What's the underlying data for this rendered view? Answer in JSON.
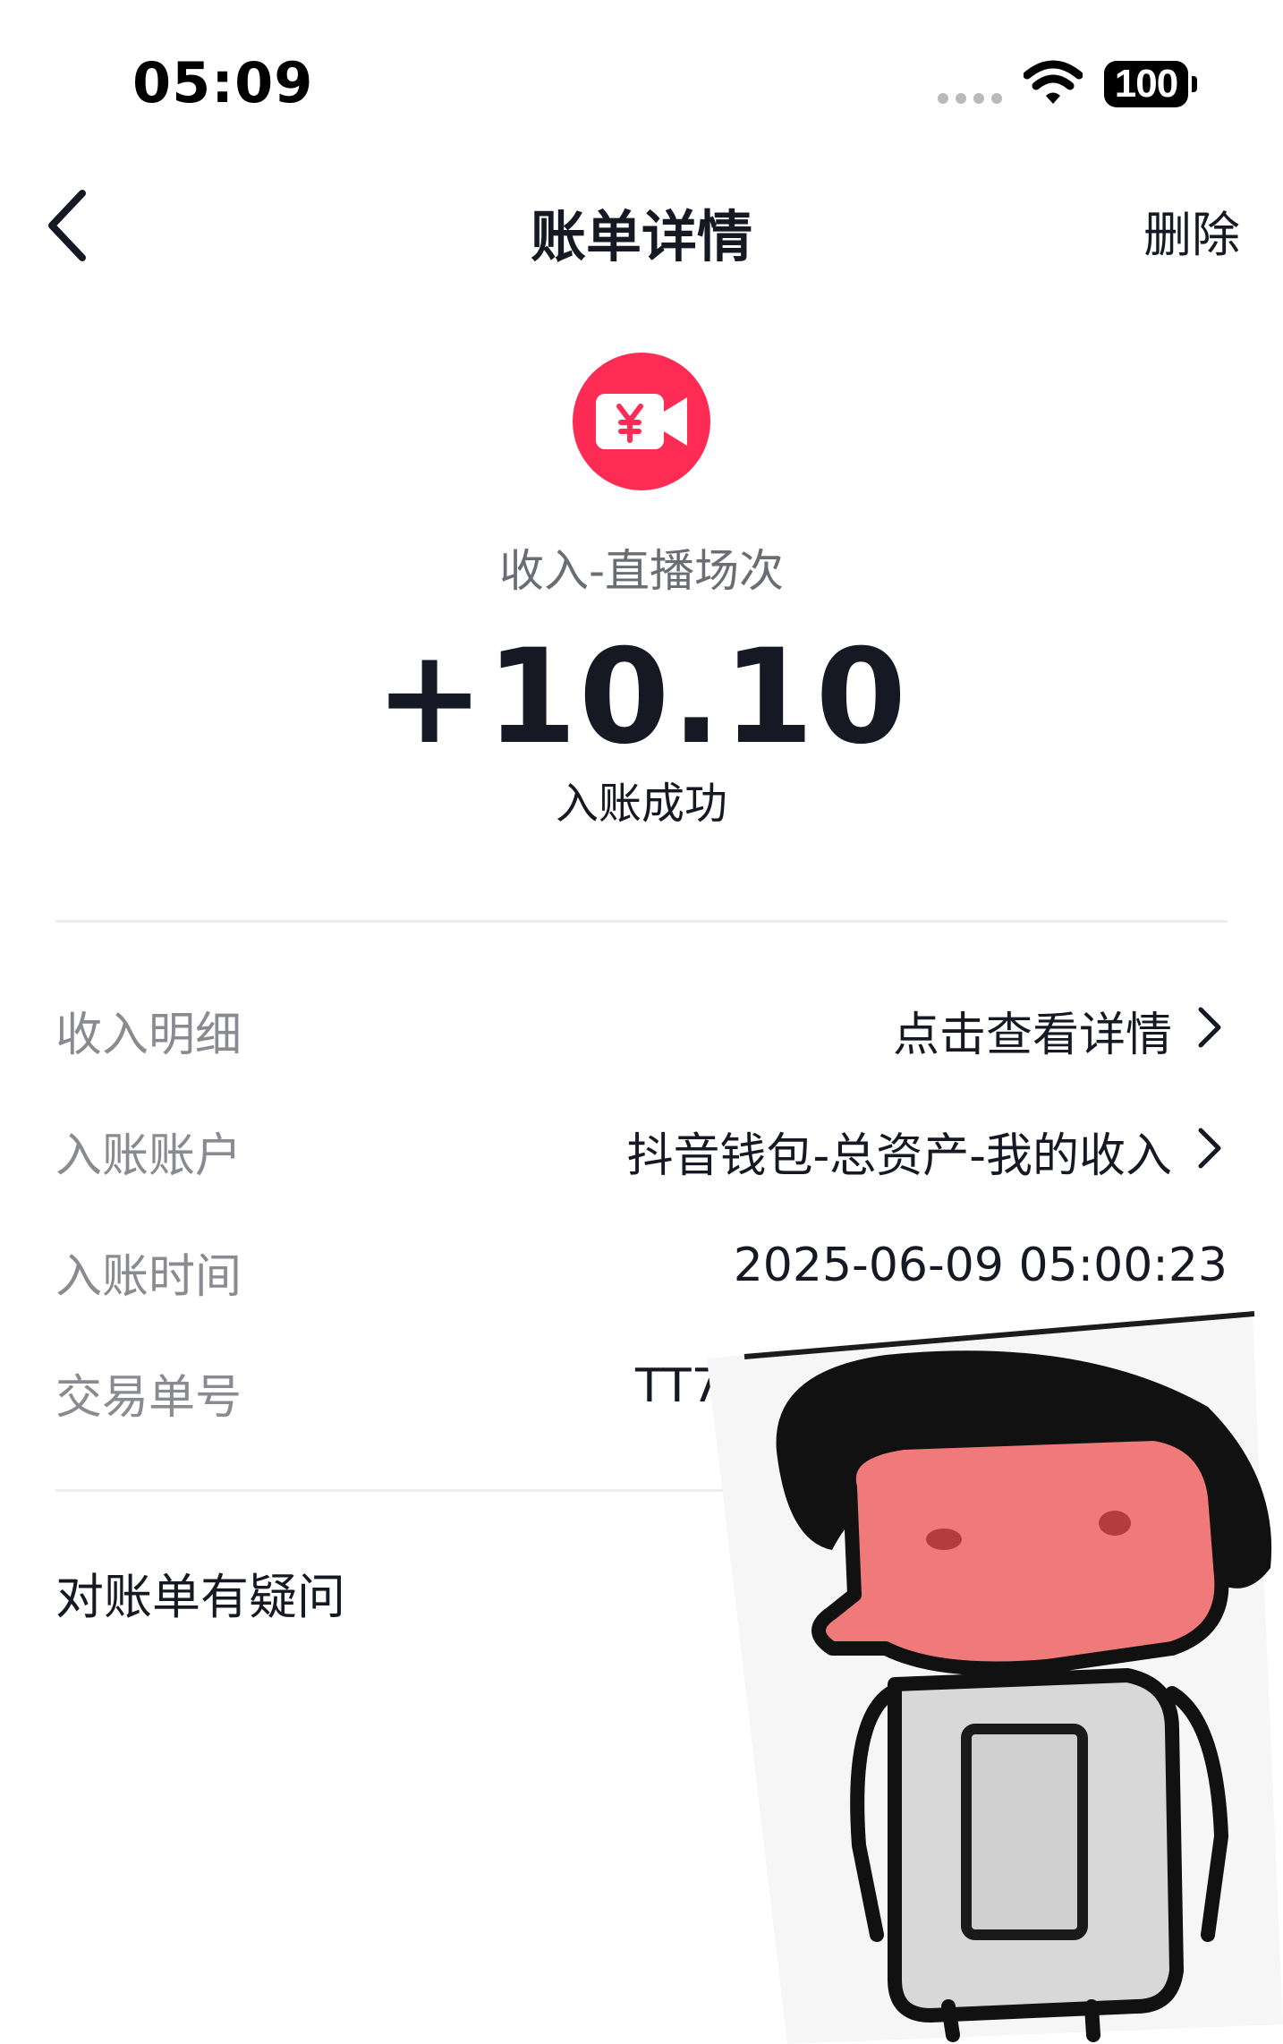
{
  "status_bar": {
    "time": "05:09",
    "battery": "100",
    "icons": [
      "cellular-dots-icon",
      "wifi-icon",
      "battery-icon"
    ]
  },
  "nav": {
    "back_icon": "chevron-left-icon",
    "title": "账单详情",
    "delete_label": "删除"
  },
  "summary": {
    "icon": "live-stream-yuan-icon",
    "income_type": "收入-直播场次",
    "amount": "+10.10",
    "status": "入账成功"
  },
  "details": [
    {
      "label": "收入明细",
      "value": "点击查看详情",
      "has_chevron": true
    },
    {
      "label": "入账账户",
      "value": "抖音钱包-总资产-我的收入",
      "has_chevron": true
    },
    {
      "label": "入账时间",
      "value": "2025-06-09 05:00:23",
      "has_chevron": false
    },
    {
      "label": "交易单号",
      "value": "TT7",
      "has_chevron": false
    }
  ],
  "question": {
    "label": "对账单有疑问"
  },
  "sticker": {
    "icon": "cartoon-sticker-icon"
  },
  "colors": {
    "accent": "#fe2c55",
    "text_primary": "#161823",
    "text_secondary": "#8a8b91",
    "divider": "#ececee",
    "sticker_face": "#f07a7a"
  }
}
